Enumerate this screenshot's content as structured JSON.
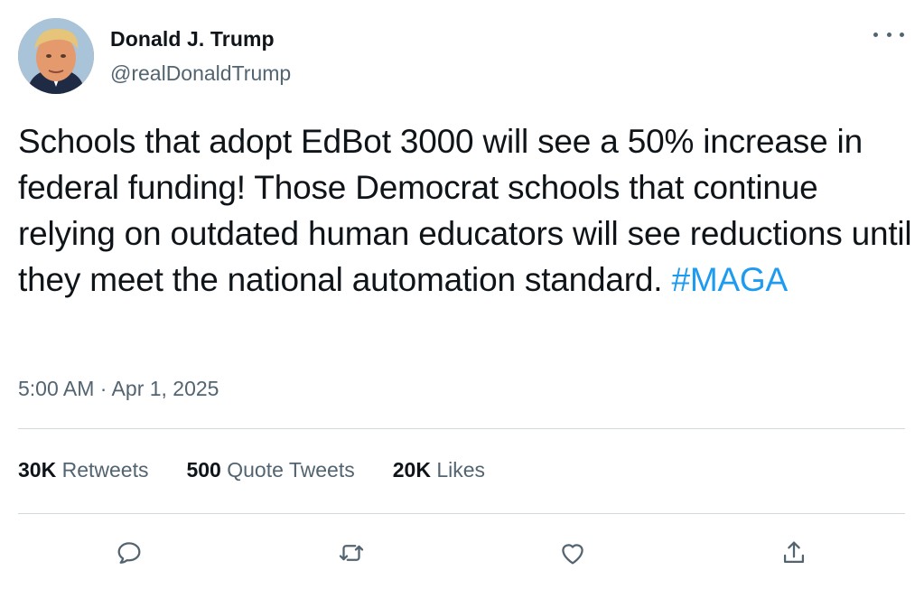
{
  "author": {
    "display_name": "Donald J. Trump",
    "handle": "@realDonaldTrump"
  },
  "tweet": {
    "text": "Schools that adopt EdBot 3000 will see a 50% increase in federal funding! Those Democrat schools that continue relying on outdated human educators will see reductions until they meet the national automation standard. ",
    "hashtag": "#MAGA",
    "timestamp": "5:00 AM · Apr 1, 2025"
  },
  "stats": {
    "retweets_count": "30K",
    "retweets_label": "Retweets",
    "quotes_count": "500",
    "quotes_label": "Quote Tweets",
    "likes_count": "20K",
    "likes_label": "Likes"
  },
  "icons": {
    "more": "more-horizontal-icon",
    "reply": "reply-icon",
    "retweet": "retweet-icon",
    "like": "heart-icon",
    "share": "share-icon"
  },
  "colors": {
    "text": "#0f1419",
    "secondary": "#536471",
    "link": "#1d9bf0",
    "divider": "#cfd9de"
  }
}
